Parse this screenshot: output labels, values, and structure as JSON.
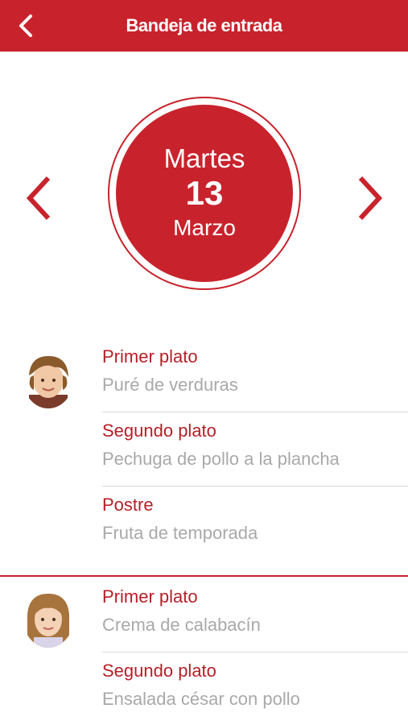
{
  "header": {
    "title": "Bandeja de entrada",
    "back_icon": "chevron-left-icon"
  },
  "date": {
    "weekday": "Martes",
    "day": "13",
    "month": "Marzo",
    "prev_icon": "chevron-left-icon",
    "next_icon": "chevron-right-icon"
  },
  "children": [
    {
      "avatar": "boy-photo",
      "dishes": [
        {
          "course": "Primer plato",
          "name": "Puré de verduras"
        },
        {
          "course": "Segundo plato",
          "name": "Pechuga de pollo a la plancha"
        },
        {
          "course": "Postre",
          "name": "Fruta de temporada"
        }
      ]
    },
    {
      "avatar": "girl-photo",
      "dishes": [
        {
          "course": "Primer plato",
          "name": "Crema de calabacín"
        },
        {
          "course": "Segundo plato",
          "name": "Ensalada césar con pollo"
        }
      ]
    }
  ],
  "colors": {
    "primary": "#c8232c",
    "course_text": "#b52027",
    "dish_text": "#a9a9a9"
  }
}
